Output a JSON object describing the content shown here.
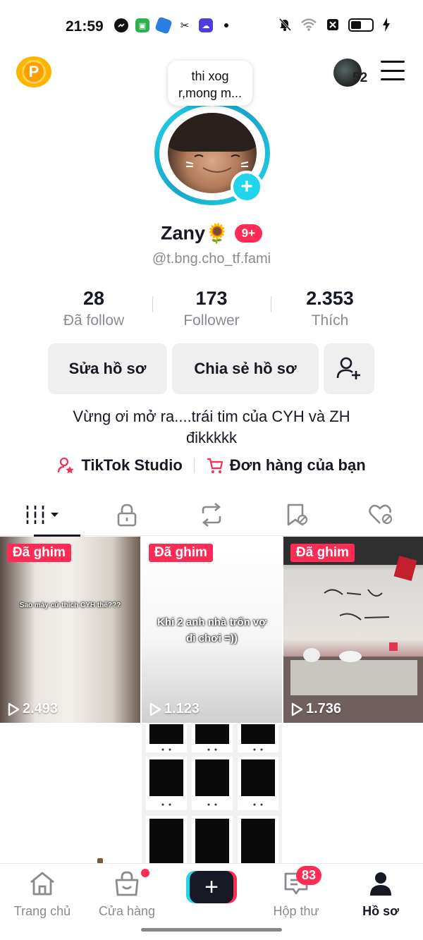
{
  "status_bar": {
    "time": "21:59"
  },
  "header": {
    "avatar_count": "52"
  },
  "note": {
    "line1": "thi xog",
    "line2": "r,mong m..."
  },
  "profile": {
    "name": "Zany",
    "name_emoji": "🌻",
    "badge": "9+",
    "handle": "@t.bng.cho_tf.fami"
  },
  "stats": [
    {
      "value": "28",
      "label": "Đã follow"
    },
    {
      "value": "173",
      "label": "Follower"
    },
    {
      "value": "2.353",
      "label": "Thích"
    }
  ],
  "actions": {
    "edit": "Sửa hồ sơ",
    "share": "Chia sẻ hồ sơ"
  },
  "bio": {
    "line1": "Vừng ơi mở ra....trái tim của CYH và ZH",
    "line2": "đikkkkk"
  },
  "links": {
    "studio": "TikTok Studio",
    "orders": "Đơn hàng của bạn"
  },
  "videos": [
    {
      "pin": "Đã ghim",
      "views": "2.493",
      "caption": "Sao mày cứ thích CYH thế???"
    },
    {
      "pin": "Đã ghim",
      "views": "1.123",
      "caption": "Khi 2 anh nhà trốn vợ đi chơi =))"
    },
    {
      "pin": "Đã ghim",
      "views": "1.736",
      "caption": ""
    }
  ],
  "bottom_nav": {
    "home": "Trang chủ",
    "shop": "Cửa hàng",
    "inbox": "Hộp thư",
    "inbox_badge": "83",
    "profile": "Hồ sơ"
  },
  "colors": {
    "accent": "#fe2c55",
    "cyan": "#20d5ec",
    "text": "#161823",
    "muted": "#8a8b91"
  }
}
